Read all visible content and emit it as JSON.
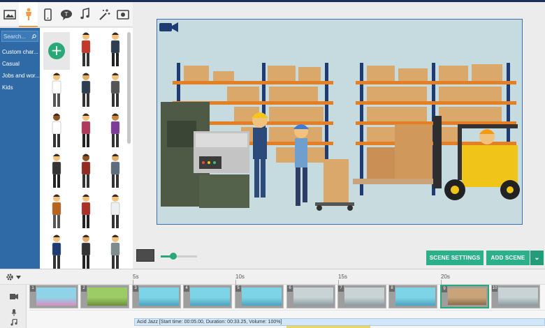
{
  "toolbar": {
    "tabs": [
      {
        "icon": "background-icon"
      },
      {
        "icon": "character-icon"
      },
      {
        "icon": "device-icon"
      },
      {
        "icon": "speech-bubble-icon"
      },
      {
        "icon": "music-icon"
      },
      {
        "icon": "effects-wand-icon"
      },
      {
        "icon": "video-icon"
      }
    ],
    "active_tab": 1,
    "accent_color": "#f39c45"
  },
  "sidebar": {
    "search_placeholder": "Search...",
    "categories": [
      "Custom char...",
      "Casual",
      "Jobs and wor...",
      "Kids"
    ]
  },
  "characters": {
    "add_button": "+",
    "count": 17
  },
  "stage": {
    "scene": "warehouse"
  },
  "controls": {
    "scene_settings_label": "SCENE SETTINGS",
    "add_scene_label": "ADD SCENE",
    "dropdown_label": "⌄",
    "zoom_level": 0.35
  },
  "timeline": {
    "ticks": [
      "5s",
      "10s",
      "15s",
      "20s"
    ],
    "clips": [
      {
        "num": "1",
        "theme": "pink"
      },
      {
        "num": "2",
        "theme": "green"
      },
      {
        "num": "3",
        "theme": "cyan"
      },
      {
        "num": "4",
        "theme": "cyan"
      },
      {
        "num": "5",
        "theme": "cyan"
      },
      {
        "num": "6",
        "theme": "gray"
      },
      {
        "num": "7",
        "theme": "gray"
      },
      {
        "num": "8",
        "theme": "cyan"
      },
      {
        "num": "9",
        "theme": "warehouse"
      },
      {
        "num": "10",
        "theme": "gray"
      }
    ],
    "selected_clip": 8,
    "music_label": "Acid Jazz [Start time: 00:05.00, Duration: 00:33.25, Volume: 100%]"
  },
  "colors": {
    "sidebar_blue": "#2f6aa6",
    "button_green": "#2bb08a",
    "stage_border": "#3d6fae"
  }
}
